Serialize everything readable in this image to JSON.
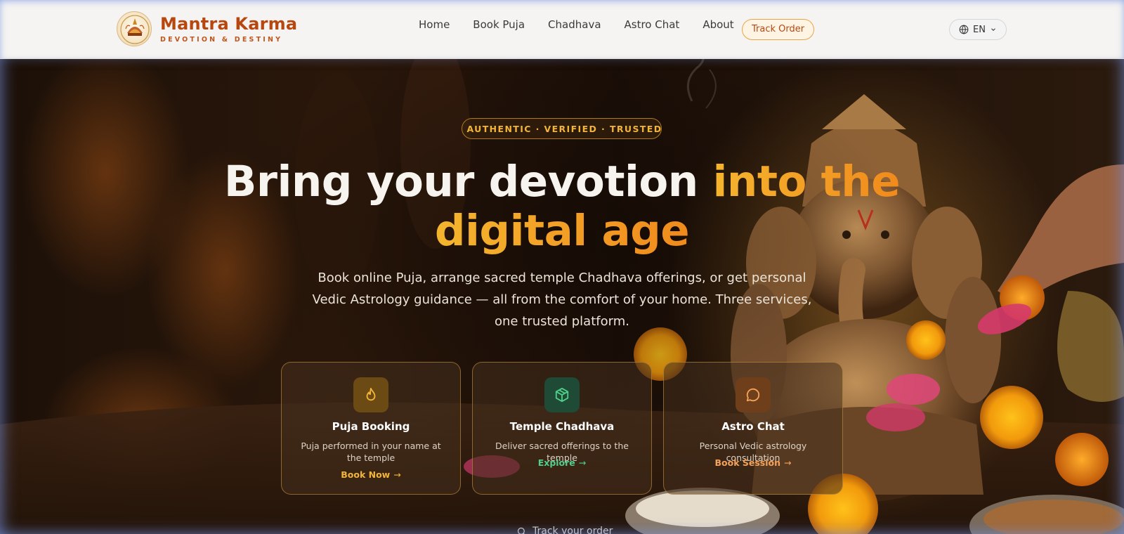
{
  "brand": {
    "name": "Mantra Karma",
    "tagline": "DEVOTION & DESTINY",
    "emblem_text": "MANTRA KARMA"
  },
  "nav": {
    "items": [
      {
        "label": "Home"
      },
      {
        "label": "Book Puja"
      },
      {
        "label": "Chadhava"
      },
      {
        "label": "Astro Chat"
      },
      {
        "label": "About"
      }
    ],
    "track_button": "Track Order",
    "language": {
      "selected": "EN",
      "icon": "globe-icon"
    }
  },
  "hero": {
    "badge": "AUTHENTIC · VERIFIED · TRUSTED",
    "headline_white": "Bring your devotion ",
    "headline_accent_1": "into the",
    "headline_accent_2": "digital age",
    "subtext": "Book online Puja, arrange sacred temple Chadhava offerings, or get personal Vedic Astrology guidance — all from the comfort of your home. Three services, one trusted platform.",
    "cards": [
      {
        "title": "Puja Booking",
        "description": "Puja performed in your name at the temple",
        "link": "Book Now",
        "icon": "flame-icon",
        "accent": "#f2b43a",
        "icon_bg": "#6b4a14"
      },
      {
        "title": "Temple Chadhava",
        "description": "Deliver sacred offerings to the temple",
        "link": "Explore",
        "icon": "box-icon",
        "accent": "#4fd08a",
        "icon_bg": "#1f4a35"
      },
      {
        "title": "Astro Chat",
        "description": "Personal Vedic astrology consultation",
        "link": "Book Session",
        "icon": "chat-bubble-icon",
        "accent": "#f5a25a",
        "icon_bg": "#6e3f1a"
      }
    ],
    "track_link": "Track your order"
  },
  "colors": {
    "brand": "#b8470f",
    "accent_gold": "#f2a62a",
    "header_bg": "#f5f4f2"
  }
}
